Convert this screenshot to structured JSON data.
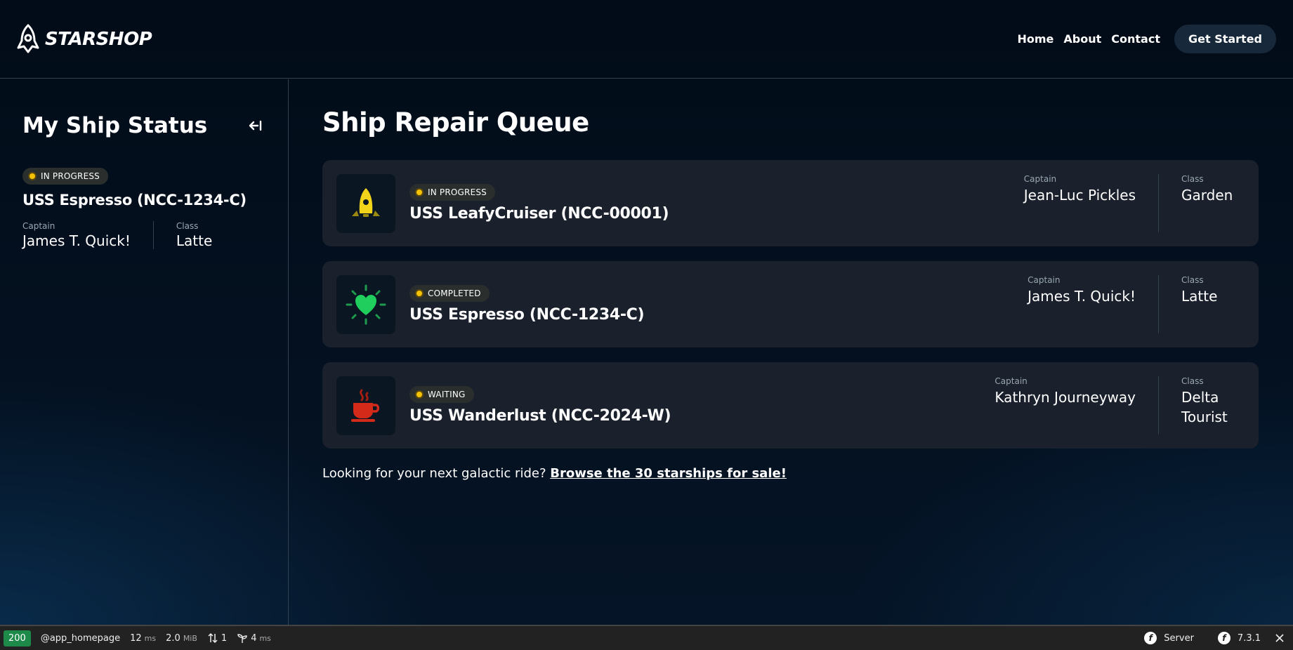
{
  "brand": {
    "name": "STARSHOP"
  },
  "nav": {
    "links": [
      "Home",
      "About",
      "Contact"
    ],
    "cta": "Get Started"
  },
  "sidebar": {
    "title": "My Ship Status",
    "status": "IN PROGRESS",
    "ship_name": "USS Espresso (NCC-1234-C)",
    "captain_label": "Captain",
    "captain": "James T. Quick!",
    "class_label": "Class",
    "class": "Latte"
  },
  "main": {
    "title": "Ship Repair Queue",
    "ships": [
      {
        "status": "IN PROGRESS",
        "name": "USS LeafyCruiser (NCC-00001)",
        "captain_label": "Captain",
        "captain": "Jean-Luc Pickles",
        "class_label": "Class",
        "class": "Garden",
        "icon": "rocket-icon"
      },
      {
        "status": "COMPLETED",
        "name": "USS Espresso (NCC-1234-C)",
        "captain_label": "Captain",
        "captain": "James T. Quick!",
        "class_label": "Class",
        "class": "Latte",
        "icon": "heart-icon"
      },
      {
        "status": "WAITING",
        "name": "USS Wanderlust (NCC-2024-W)",
        "captain_label": "Captain",
        "captain": "Kathryn Journeyway",
        "class_label": "Class",
        "class": "Delta Tourist",
        "icon": "coffee-cup-icon"
      }
    ],
    "footer_text": "Looking for your next galactic ride?",
    "footer_link": "Browse the 30 starships for sale!"
  },
  "toolbar": {
    "status_code": "200",
    "route": "@app_homepage",
    "time_value": "12",
    "time_unit": "ms",
    "memory_value": "2.0",
    "memory_unit": "MiB",
    "requests": "1",
    "render_value": "4",
    "render_unit": "ms",
    "server": "Server",
    "version": "7.3.1"
  },
  "colors": {
    "background": "#020c18",
    "card": "#1a202c",
    "status_dot": "#f5c400",
    "status_ok": "#1d8a4a"
  }
}
